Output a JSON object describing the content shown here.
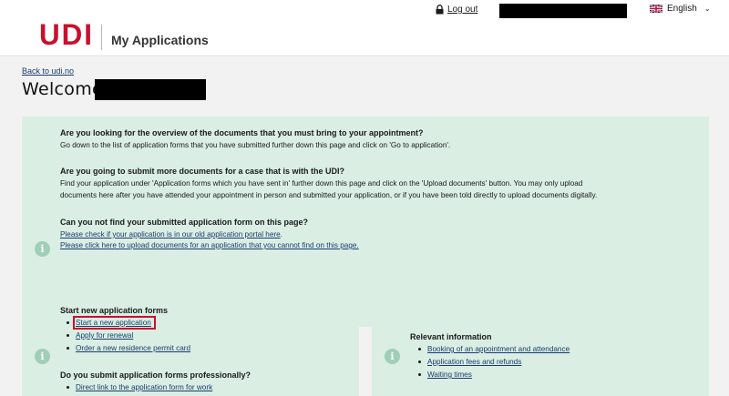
{
  "header": {
    "logo_text": "UDI",
    "app_title": "My Applications",
    "logout_label": "Log out",
    "language_label": "English"
  },
  "page": {
    "back_link": "Back to udi.no",
    "welcome": "Welcome,"
  },
  "notice": {
    "q1": "Are you looking for the overview of the documents that you must bring to your appointment?",
    "a1": "Go down to the list of application forms that you have submitted further down this page and click on 'Go to application'.",
    "q2": "Are you going to submit more documents for a case that is with the UDI?",
    "a2_line1": "Find your application under 'Application forms which you have sent in' further down this page and click on the 'Upload documents' button. You may only upload",
    "a2_line2": "documents here after you have attended your appointment in person and submitted your application, or if you have been told directly to upload documents digitally.",
    "q3": "Can you not find your submitted application form on this page?",
    "link1": "Please check if your application is in our old application portal here",
    "link1_suffix": ".",
    "link2": "Please click here to upload documents for an application that you cannot find on this page."
  },
  "start_forms": {
    "heading": "Start new application forms",
    "items": [
      "Start a new application",
      "Apply for renewal",
      "Order a new residence permit card"
    ],
    "pro_heading": "Do you submit application forms professionally?",
    "pro_items": [
      "Direct link to the application form for work"
    ]
  },
  "relevant": {
    "heading": "Relevant information",
    "items": [
      "Booking of an appointment and attendance",
      "Application fees and refunds",
      "Waiting times"
    ]
  },
  "colors": {
    "brand_red": "#c8102e",
    "panel_green": "#daeee4",
    "info_icon": "#9fcfb7",
    "link_blue": "#1a3c6e"
  },
  "icons": [
    "lock-icon",
    "uk-flag-icon",
    "chevron-down-icon",
    "info-icon"
  ]
}
